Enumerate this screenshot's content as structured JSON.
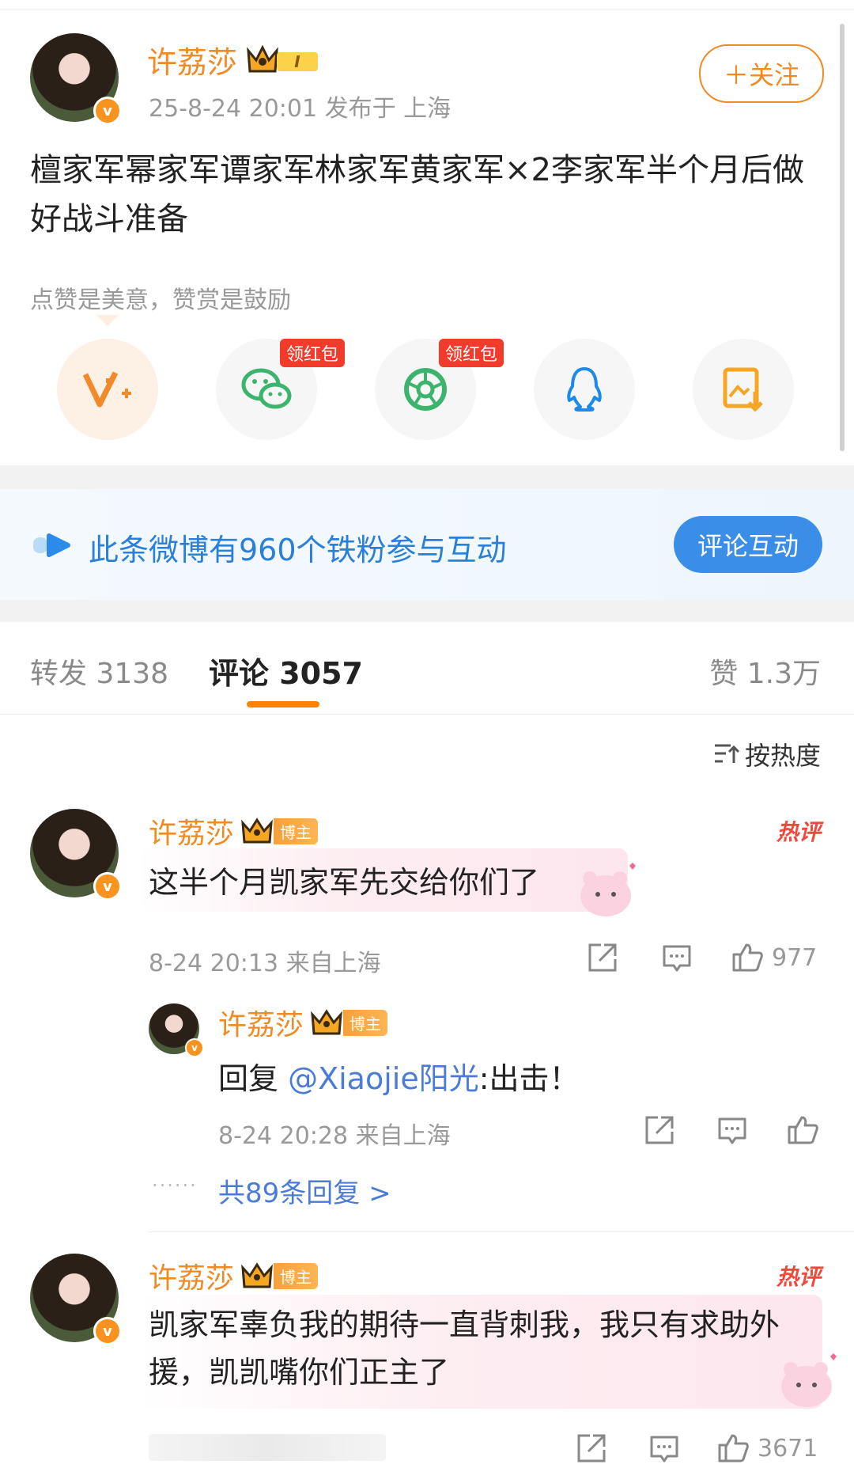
{
  "post": {
    "author": "许荔莎",
    "level": "I",
    "meta": "25-8-24 20:01  发布于 上海",
    "follow_label": "＋关注",
    "content": "檀家军幂家军谭家军林家军黄家军×2李家军半个月后做好战斗准备",
    "tip_text": "点赞是美意，赞赏是鼓励",
    "hongbao_label": "领红包"
  },
  "banner": {
    "text": "此条微博有960个铁粉参与互动",
    "button_label": "评论互动"
  },
  "tabs": {
    "repost": "转发 3138",
    "comments": "评论 3057",
    "likes": "赞 1.3万",
    "sort_label": "按热度"
  },
  "comments": [
    {
      "author": "许荔莎",
      "tag": "博主",
      "hot_badge": "热评",
      "text": "这半个月凯家军先交给你们了",
      "time": "8-24 20:13  来自上海",
      "likes": "977",
      "reply": {
        "author": "许荔莎",
        "tag": "博主",
        "prefix": "回复 ",
        "mention": "@Xiaojie阳光",
        "text": ":出击！",
        "time": "8-24 20:28  来自上海"
      },
      "more_replies": "共89条回复 >"
    },
    {
      "author": "许荔莎",
      "tag": "博主",
      "hot_badge": "热评",
      "text": "凯家军辜负我的期待一直背刺我，我只有求助外援，凯凯嘴你们正主了",
      "likes": "3671"
    }
  ],
  "colors": {
    "accent": "#f08a24",
    "link": "#4a7bd6",
    "hot": "#f0483c",
    "tab_underline": "#ff8200"
  }
}
